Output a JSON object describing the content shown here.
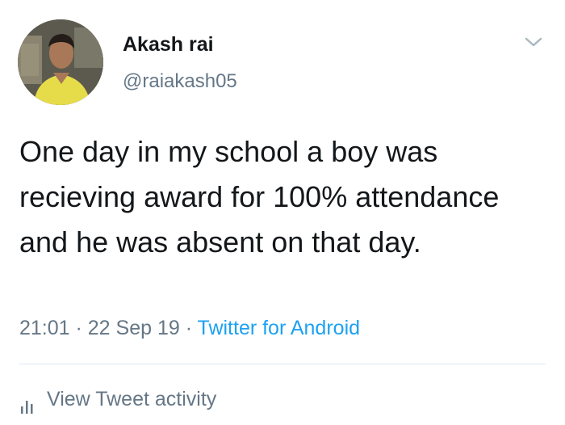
{
  "user": {
    "display_name": "Akash rai",
    "handle": "@raiakash05"
  },
  "tweet": {
    "text": "One day in my school a boy was recieving award for 100% attendance and he was absent on that day.",
    "time": "21:01",
    "sep1": " · ",
    "date": "22 Sep 19",
    "sep2": " · ",
    "source": "Twitter for Android"
  },
  "actions": {
    "activity_label": "View Tweet activity"
  },
  "icons": {
    "menu": "chevron-down-icon",
    "activity": "bar-chart-icon"
  },
  "colors": {
    "text": "#14171a",
    "secondary": "#657786",
    "link": "#1da1f2",
    "divider": "#e1e8ed"
  }
}
